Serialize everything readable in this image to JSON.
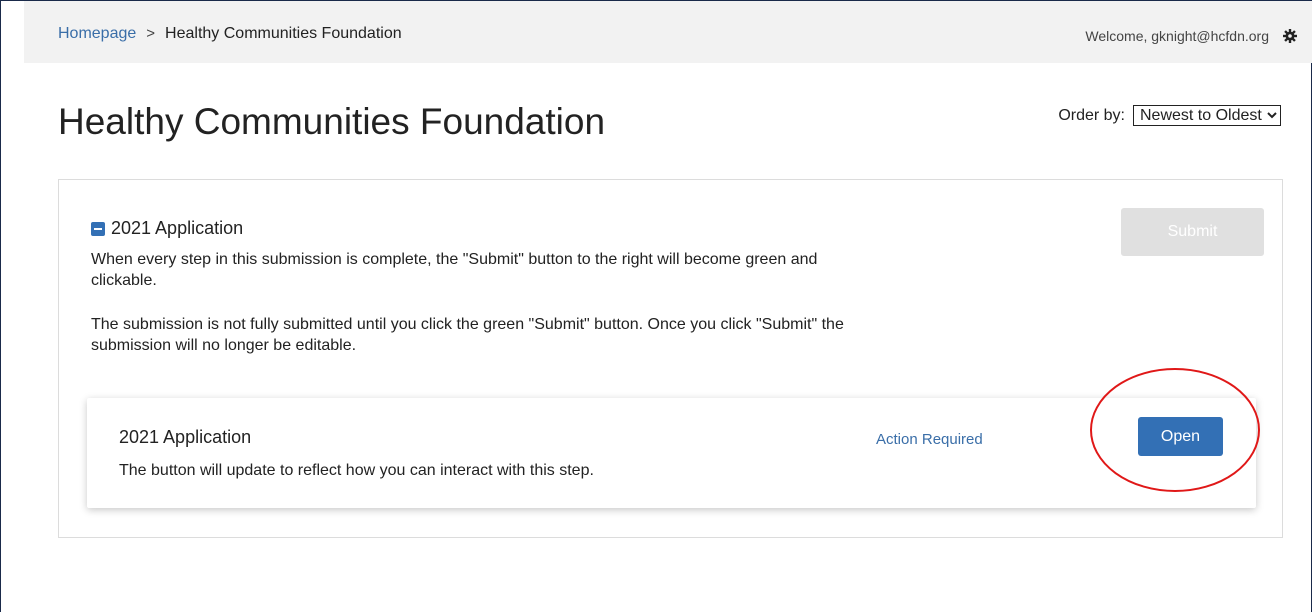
{
  "breadcrumb": {
    "home": "Homepage",
    "separator": ">",
    "current": "Healthy Communities Foundation"
  },
  "header": {
    "welcome": "Welcome, gknight@hcfdn.org",
    "settings_icon": "gear-icon"
  },
  "page": {
    "title": "Healthy Communities Foundation",
    "order_label": "Order by:",
    "order_selected": "Newest to Oldest"
  },
  "submission": {
    "title": "2021 Application",
    "toggle_icon": "collapse-minus-icon",
    "description_1": "When every step in this submission is complete, the \"Submit\" button to the right will become green and clickable.",
    "description_2": "The submission is not fully submitted until you click the green \"Submit\" button. Once you click \"Submit\" the submission will no longer be editable.",
    "submit_label": "Submit",
    "submit_enabled": false,
    "step": {
      "title": "2021 Application",
      "description": "The button will update to reflect how you can interact with this step.",
      "status": "Action Required",
      "button_label": "Open"
    }
  },
  "colors": {
    "primary": "#3370b5",
    "link": "#3a6ea8",
    "disabled": "#e0e0e0",
    "annotation": "#e01818"
  }
}
